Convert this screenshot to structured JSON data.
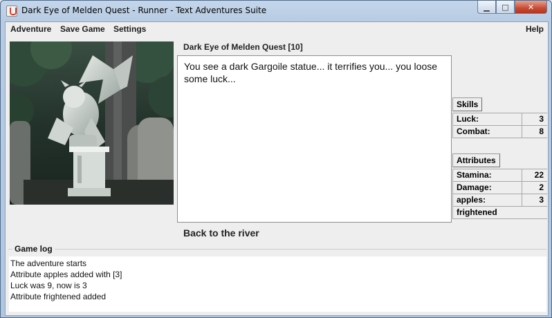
{
  "window": {
    "title": "Dark Eye of Melden Quest - Runner - Text Adventures Suite",
    "minimize_icon": "minimize-icon",
    "maximize_icon": "maximize-icon",
    "close_icon": "close-icon"
  },
  "menubar": {
    "items": [
      "Adventure",
      "Save Game",
      "Settings"
    ],
    "help": "Help"
  },
  "scene": {
    "quest_title": "Dark Eye of Melden Quest [10]",
    "story_text": "You see a dark Gargoile statue... it terrifies you... you loose some luck...",
    "choice": "Back to the river"
  },
  "skills": {
    "header": "Skills",
    "rows": [
      {
        "name": "Luck:",
        "value": "3"
      },
      {
        "name": "Combat:",
        "value": "8"
      }
    ]
  },
  "attributes": {
    "header": "Attributes",
    "rows": [
      {
        "name": "Stamina:",
        "value": "22"
      },
      {
        "name": "Damage:",
        "value": "2"
      },
      {
        "name": "apples:",
        "value": "3"
      }
    ],
    "flag": "frightened"
  },
  "game_log": {
    "label": "Game log",
    "lines": [
      "The adventure starts",
      "Attribute apples added with [3]",
      "Luck was 9, now is 3",
      "Attribute frightened added"
    ]
  },
  "colors": {
    "accent_close": "#c74b34",
    "window_frame": "#b7cbe3",
    "client_bg": "#eeeeee"
  }
}
